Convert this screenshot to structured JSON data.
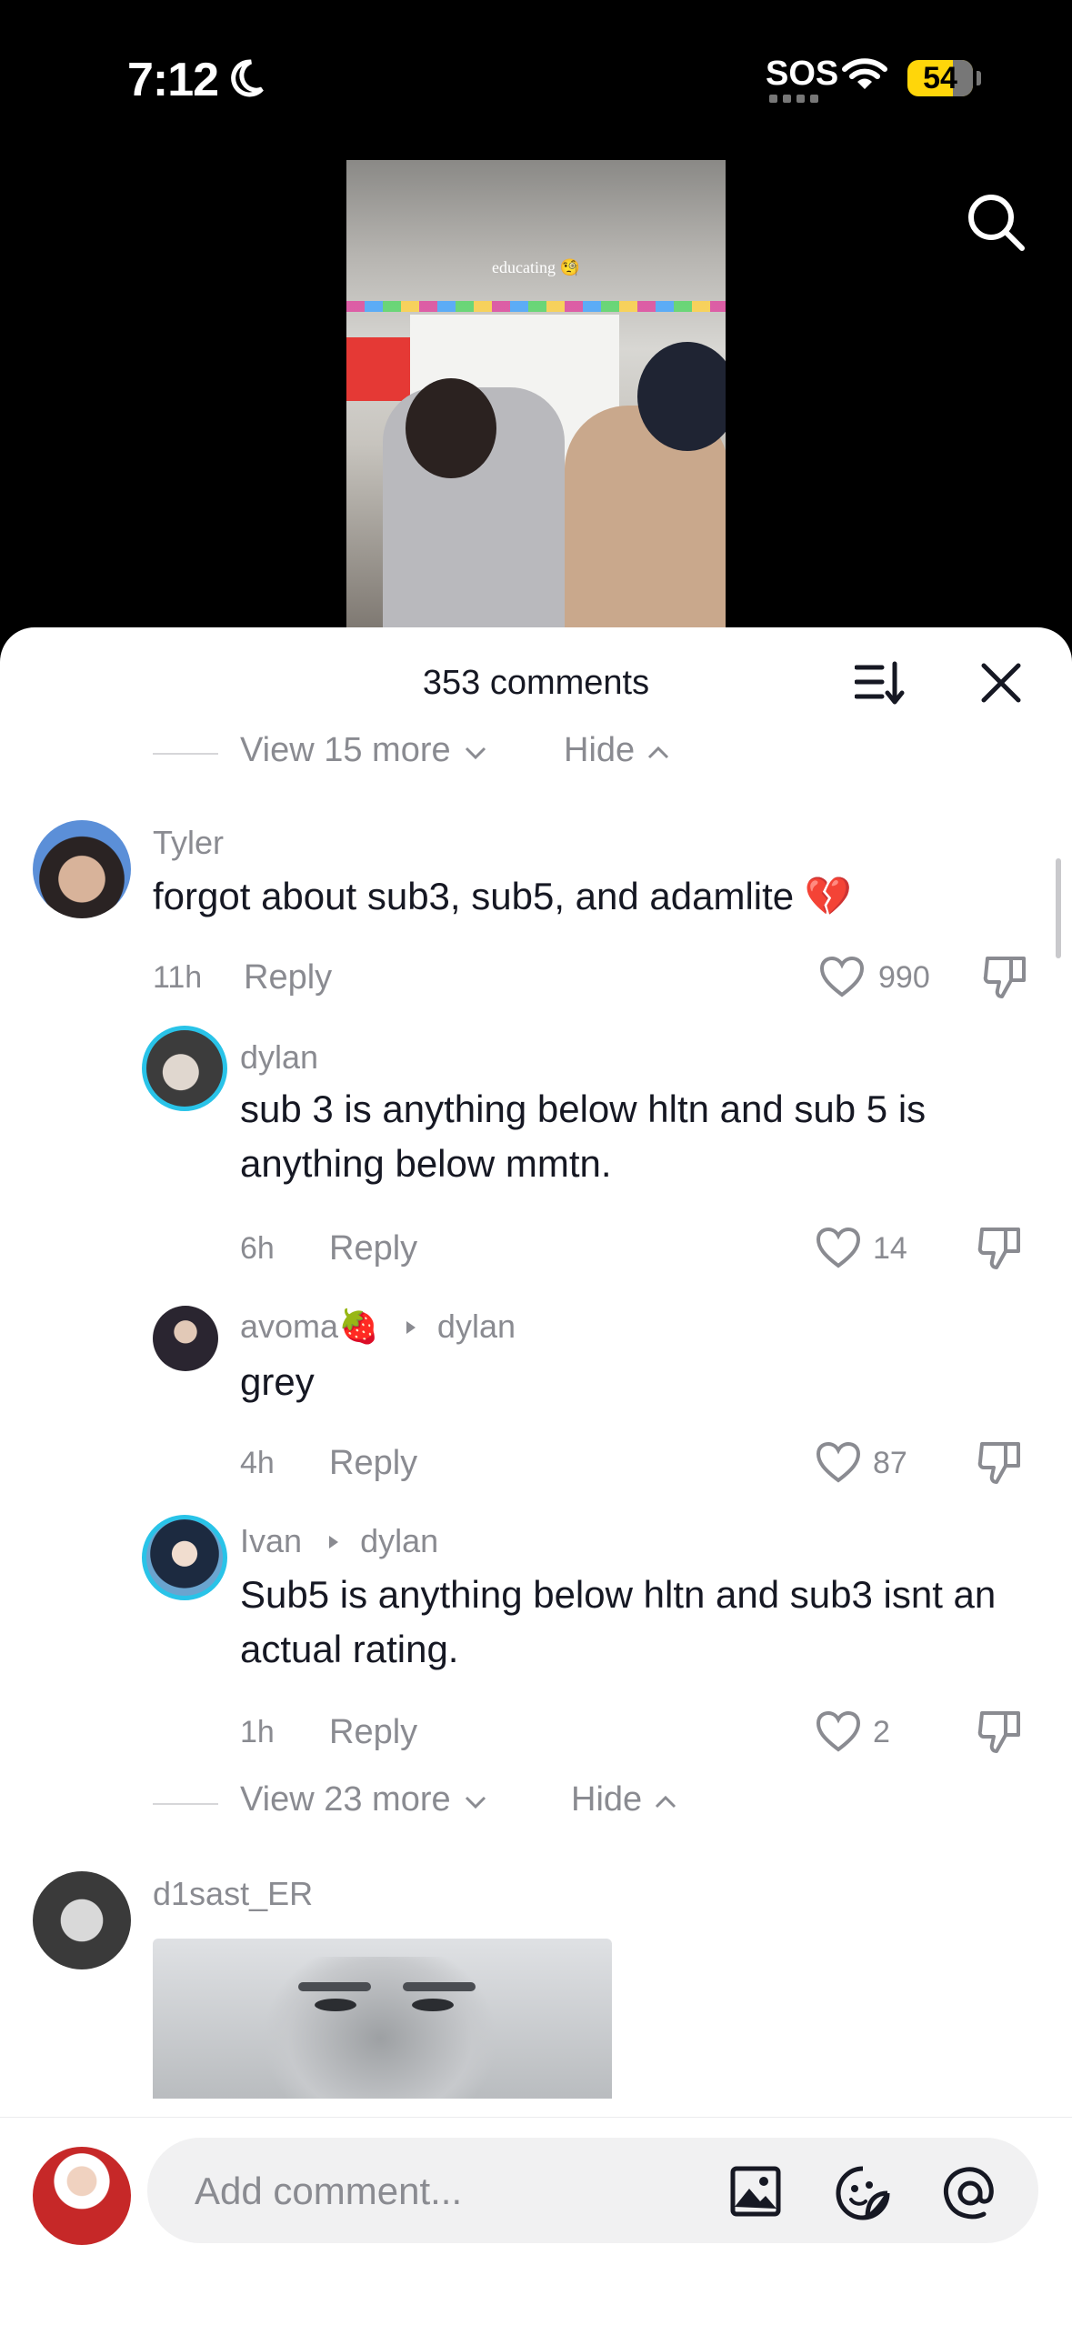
{
  "status_bar": {
    "time": "7:12",
    "carrier_text": "SOS",
    "battery": "54",
    "battery_color": "#ffd60a"
  },
  "video": {
    "caption": "educating 🧐"
  },
  "header": {
    "comment_count": "353 comments",
    "icons": [
      "sort-icon",
      "close-icon",
      "search-icon"
    ]
  },
  "threads": [
    {
      "top_view_more": "View 15 more",
      "top_hide": "Hide",
      "comment": {
        "username": "Tyler",
        "text": "forgot about sub3, sub5, and adamlite 💔",
        "time": "11h",
        "reply_label": "Reply",
        "likes": "990"
      },
      "replies": [
        {
          "username": "dylan",
          "text": "sub 3 is anything below hltn and sub 5 is anything below mmtn.",
          "time": "6h",
          "reply_label": "Reply",
          "likes": "14"
        },
        {
          "username": "avoma🍓",
          "reply_to": "dylan",
          "text": "grey",
          "time": "4h",
          "reply_label": "Reply",
          "likes": "87"
        },
        {
          "username": "Ivan",
          "reply_to": "dylan",
          "text": "Sub5 is anything below hltn and sub3 isnt an actual rating.",
          "time": "1h",
          "reply_label": "Reply",
          "likes": "2"
        }
      ],
      "bottom_view_more": "View 23 more",
      "bottom_hide": "Hide"
    },
    {
      "comment": {
        "username": "d1sast_ER"
      }
    }
  ],
  "composer": {
    "placeholder": "Add comment...",
    "icons": [
      "image-icon",
      "sticker-icon",
      "mention-icon"
    ]
  }
}
